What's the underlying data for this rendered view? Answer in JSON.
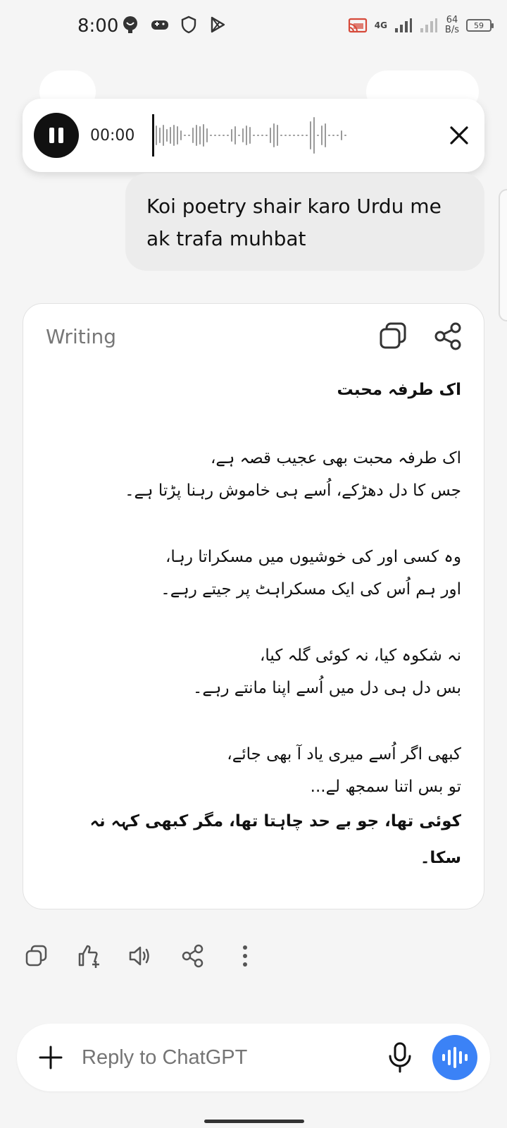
{
  "status_bar": {
    "time": "8:00",
    "network_label": "4G",
    "speed_value": "64",
    "speed_unit": "B/s",
    "battery": "59"
  },
  "audio_player": {
    "time": "00:00",
    "progress": 0
  },
  "user_message": {
    "text": "Koi poetry shair karo Urdu me ak trafa muhbat"
  },
  "response_card": {
    "label": "Writing",
    "poem": {
      "title": "اک طرفہ محبت",
      "stanza1": [
        "اک طرفہ محبت بھی عجیب قصہ ہے،",
        "جس کا دل دھڑکے، اُسے ہی خاموش رہنا پڑتا ہے۔"
      ],
      "stanza2": [
        "وہ کسی اور کی خوشیوں میں مسکراتا رہا،",
        "اور ہم اُس کی ایک مسکراہٹ پر جیتے رہے۔"
      ],
      "stanza3": [
        "نہ شکوہ کیا، نہ کوئی گلہ کیا،",
        "بس دل ہی دل میں اُسے اپنا مانتے رہے۔"
      ],
      "stanza4": [
        "کبھی اگر اُسے میری یاد آ بھی جائے،",
        "تو بس اتنا سمجھ لے..."
      ],
      "closing": "کوئی تھا، جو بے حد چاہتا تھا، مگر کبھی کہہ نہ سکا۔"
    }
  },
  "composer": {
    "placeholder": "Reply to ChatGPT"
  },
  "colors": {
    "accent": "#3b82f6",
    "background": "#f5f5f5",
    "bubble": "#ececec"
  }
}
